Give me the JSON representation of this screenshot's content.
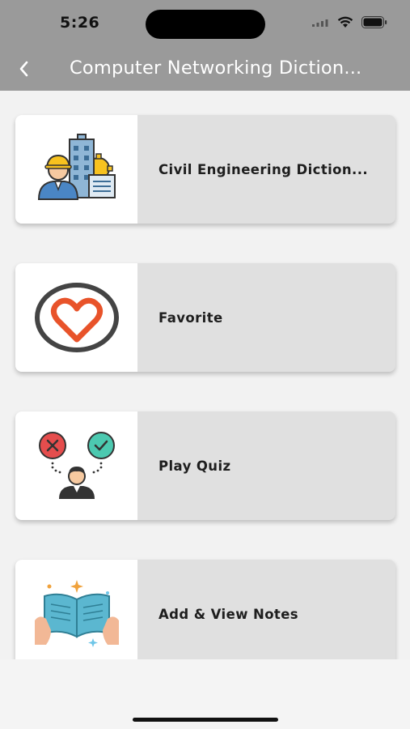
{
  "status": {
    "time": "5:26"
  },
  "nav": {
    "title": "Computer Networking Diction..."
  },
  "cards": [
    {
      "label": "Civil Engineering Diction...",
      "icon": "engineer-building-icon"
    },
    {
      "label": "Favorite",
      "icon": "heart-icon"
    },
    {
      "label": "Play Quiz",
      "icon": "quiz-person-icon"
    },
    {
      "label": "Add & View Notes",
      "icon": "open-book-icon"
    }
  ],
  "colors": {
    "nav_bg": "#9a9a9a",
    "card_bg": "#e0e0e0",
    "accent": "#e8532a"
  }
}
